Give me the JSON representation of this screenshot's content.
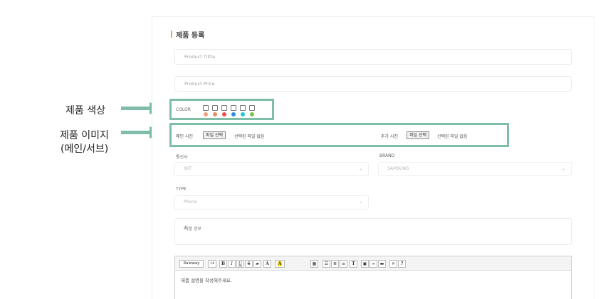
{
  "annotations": {
    "color_label": "제품 색상",
    "image_label_line1": "제품 이미지",
    "image_label_line2": "(메인/서브)"
  },
  "form": {
    "title": "제품 등록",
    "title_placeholder": "Product Tittle",
    "price_placeholder": "Product Price",
    "color_label": "COLOR",
    "colors": [
      "#f0a07e",
      "#e98b6a",
      "#e94f4f",
      "#2e8fd8",
      "#28c6c7",
      "#7cc34b"
    ],
    "main_photo_label": "메인 사진",
    "main_photo_button": "파일 선택",
    "main_photo_status": "선택된 파일 없음",
    "sub_photo_label": "추가 사진",
    "sub_photo_button": "파일 선택",
    "sub_photo_status": "선택된 파일 없음",
    "carrier_label": "통신사",
    "carrier_value": "SKT",
    "brand_label": "BRAND",
    "brand_value": "SAMSUNG",
    "type_label": "TYPE",
    "type_value": "Phone",
    "info_placeholder": "제품 정보",
    "editor_font": "Raleway",
    "editor_size": "14",
    "editor_placeholder": "제품 설명을 작성해주세요."
  },
  "colors": {
    "accent": "#f0a35a",
    "highlight": "#7fbea6"
  }
}
